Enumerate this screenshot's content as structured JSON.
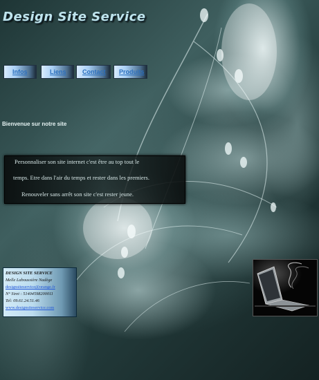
{
  "site": {
    "title": "Design Site Service"
  },
  "nav": {
    "items": [
      {
        "label": "Infos"
      },
      {
        "label": "Liens"
      },
      {
        "label": "Contact"
      },
      {
        "label": "Produits"
      }
    ]
  },
  "welcome": {
    "text": "Bienvenue sur notre site"
  },
  "intro": {
    "lines": [
      "Personnaliser son site internet c'est être au top tout le",
      "temps. Etre dans l'air du temps et rester dans les premiers.",
      "Renouveler sans arrêt son site c'est rester jeune."
    ]
  },
  "contact_card": {
    "company": "DESIGN SITE SERVICE",
    "person": "Melle Laboussière Nadège",
    "email": "designsiteservice@orange.fr",
    "siret": "N° Siret : 51404598200011",
    "phone": "Tel: 09.61.24.51.46",
    "website": "www.designsiteservice.com"
  },
  "images": {
    "laptop_photo": "laptop-smoke-image"
  },
  "colors": {
    "title": "#bfe4ec",
    "nav_link": "#2a6fbf",
    "background_dark": "#0b1414"
  }
}
